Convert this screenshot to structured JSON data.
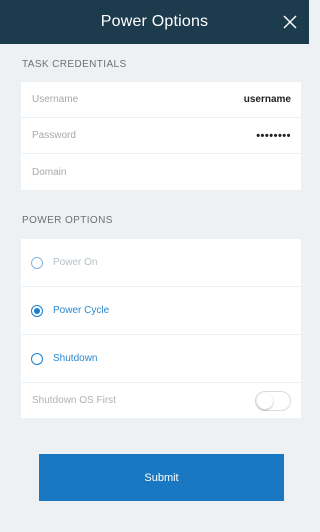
{
  "header": {
    "title": "Power Options",
    "close_icon": "close-icon"
  },
  "credentials": {
    "section_label": "TASK CREDENTIALS",
    "fields": [
      {
        "label": "Username",
        "value": "username"
      },
      {
        "label": "Password",
        "value": "••••••••"
      },
      {
        "label": "Domain",
        "value": ""
      }
    ]
  },
  "power_options": {
    "section_label": "POWER OPTIONS",
    "options": [
      {
        "label": "Power On",
        "selected": false,
        "enabled": false
      },
      {
        "label": "Power Cycle",
        "selected": true,
        "enabled": true
      },
      {
        "label": "Shutdown",
        "selected": false,
        "enabled": true
      }
    ],
    "shutdown_os_first": {
      "label": "Shutdown OS First",
      "on": false,
      "enabled": false
    }
  },
  "submit_label": "Submit",
  "colors": {
    "header_bg": "#1c3b4d",
    "accent": "#1a7fd0",
    "submit_bg": "#1a78c2",
    "page_bg": "#eef1f3"
  }
}
